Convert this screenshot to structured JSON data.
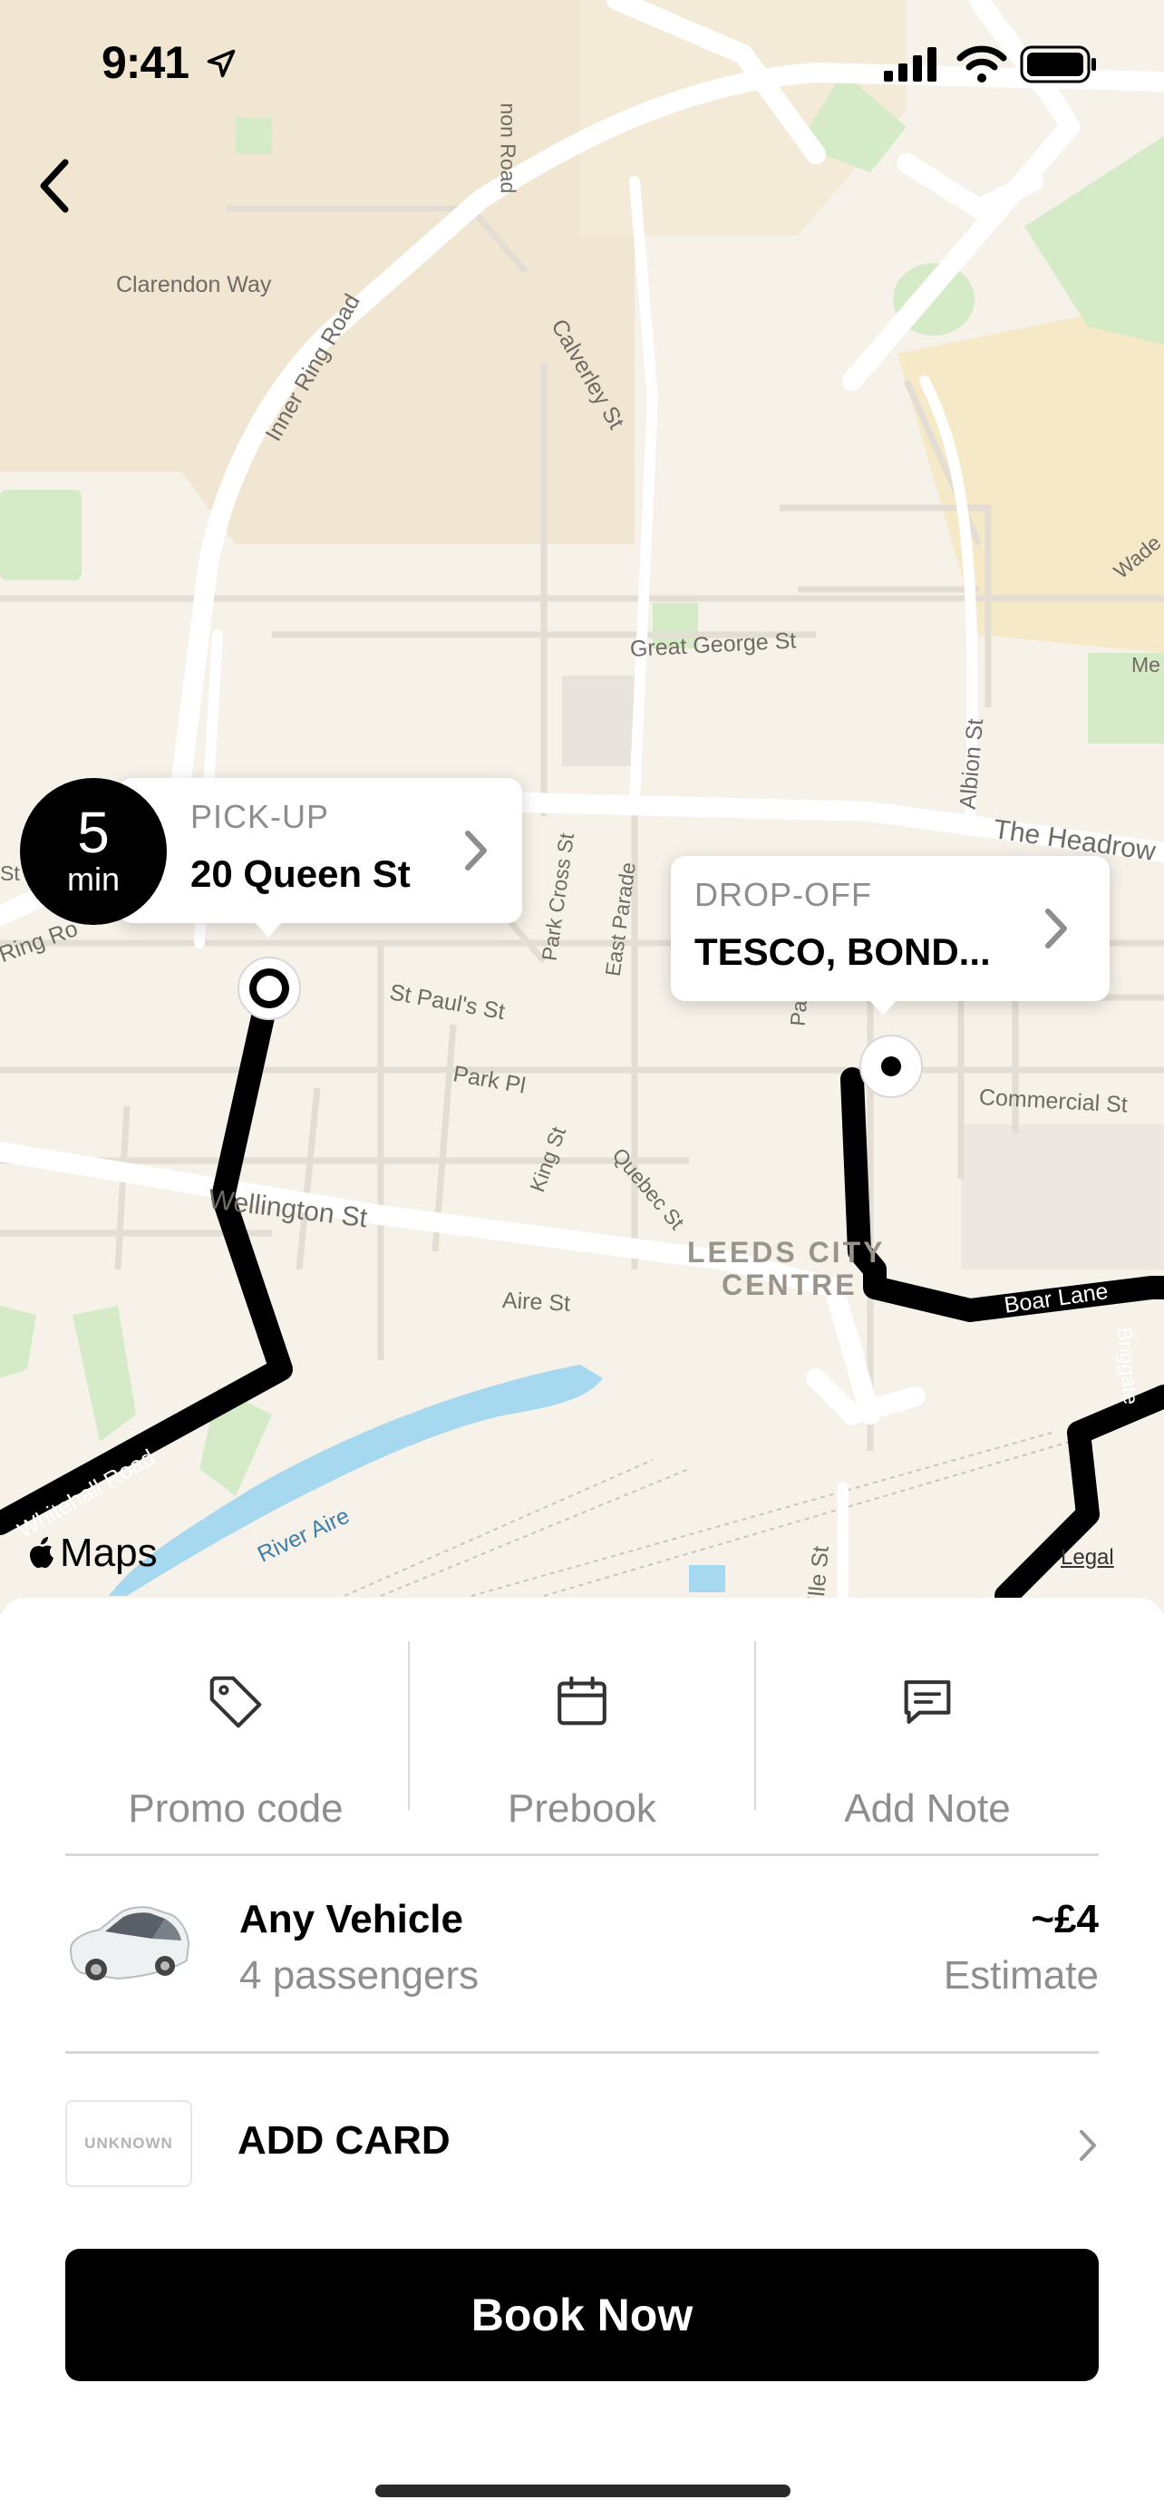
{
  "status_bar": {
    "time": "9:41"
  },
  "map": {
    "labels": {
      "clarendon_way": "Clarendon Way",
      "inner_ring_road": "Inner Ring Road",
      "calverley_st": "Calverley St",
      "great_george_st": "Great George St",
      "albion_st": "Albion St",
      "the_headrow": "The Headrow",
      "park_cross_st": "Park Cross St",
      "east_parade": "East Parade",
      "park_row": "Park R",
      "st_pauls_st": "St Paul's St",
      "park_pl": "Park Pl",
      "king_st": "King St",
      "quebec_st": "Quebec St",
      "commercial_st": "Commercial St",
      "wellington_st": "Wellington St",
      "aire_st": "Aire St",
      "leeds_city_centre_1": "LEEDS CITY",
      "leeds_city_centre_2": "CENTRE",
      "boar_lane": "Boar Lane",
      "briggate": "Briggate",
      "whitehall_road": "Whitehall Road",
      "river_aire": "River Aire",
      "ville_st": "ville St",
      "ring_ro": "Ring Ro",
      "st_fragment": "St",
      "non_road": "non Road",
      "wade": "Wade",
      "me": "Me"
    },
    "maps_brand": "Maps",
    "legal": "Legal"
  },
  "eta": {
    "value": "5",
    "unit": "min"
  },
  "pickup": {
    "kicker": "PICK-UP",
    "address": "20 Queen St"
  },
  "dropoff": {
    "kicker": "DROP-OFF",
    "address": "TESCO, BOND..."
  },
  "actions": {
    "promo": "Promo code",
    "prebook": "Prebook",
    "note": "Add Note"
  },
  "vehicle": {
    "name": "Any Vehicle",
    "passengers": "4 passengers",
    "price": "~£4",
    "price_note": "Estimate"
  },
  "payment": {
    "badge": "UNKNOWN",
    "label": "ADD CARD"
  },
  "book_button": "Book Now",
  "colors": {
    "route": "#000000",
    "map_bg": "#f6f1e9",
    "road": "#ffffff",
    "park": "#d5ebc7",
    "water": "#a6d8ef"
  }
}
